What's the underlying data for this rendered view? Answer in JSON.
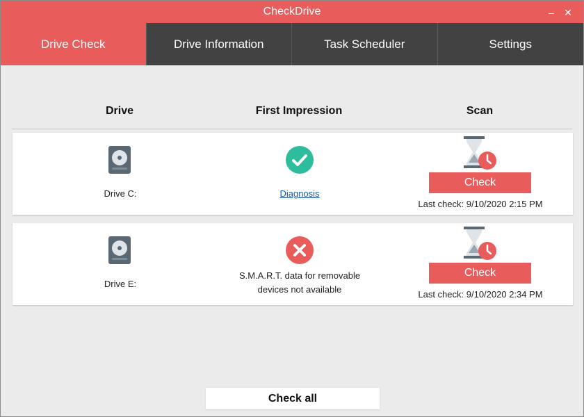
{
  "app": {
    "title": "CheckDrive",
    "minimize_glyph": "–",
    "close_glyph": "✕"
  },
  "tabs": [
    {
      "label": "Drive Check",
      "active": true
    },
    {
      "label": "Drive Information",
      "active": false
    },
    {
      "label": "Task Scheduler",
      "active": false
    },
    {
      "label": "Settings",
      "active": false
    }
  ],
  "table": {
    "headers": {
      "drive": "Drive",
      "first_impression": "First Impression",
      "scan": "Scan"
    },
    "rows": [
      {
        "drive": "Drive C:",
        "status": "ok",
        "status_icon": "check-circle-icon",
        "impression_link": "Diagnosis",
        "check_label": "Check",
        "last_check": "Last check:  9/10/2020 2:15 PM"
      },
      {
        "drive": "Drive E:",
        "status": "error",
        "status_icon": "x-circle-icon",
        "impression_line1": "S.M.A.R.T. data for removable",
        "impression_line2": "devices not available",
        "check_label": "Check",
        "last_check": "Last check:  9/10/2020 2:34 PM"
      }
    ]
  },
  "footer": {
    "check_all_label": "Check all"
  },
  "colors": {
    "accent": "#e85c5c",
    "tab_dark": "#424242",
    "ok_green": "#2ebd9c",
    "link": "#1a5a9c"
  }
}
